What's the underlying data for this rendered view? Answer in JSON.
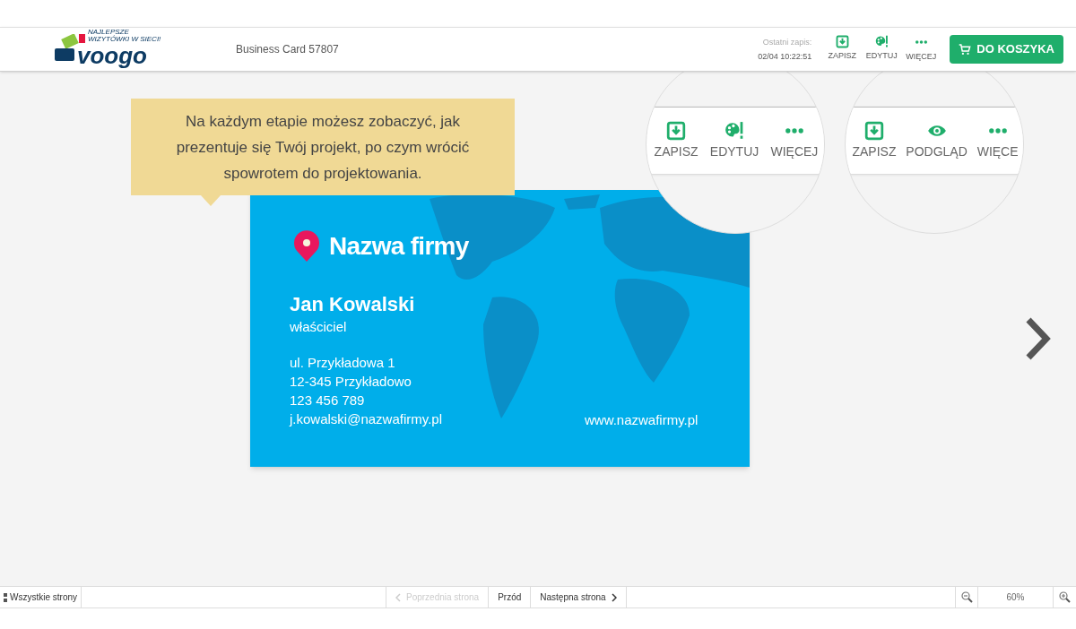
{
  "header": {
    "logo": {
      "tagline": "NAJLEPSZE WIZYTÓWKI W SIECI!",
      "wordmark": "voogo"
    },
    "project_title": "Business Card 57807",
    "last_save_label": "Ostatni zapis:",
    "last_save_time": "02/04 10:22:51",
    "actions": [
      {
        "kind": "save",
        "label": "ZAPISZ"
      },
      {
        "kind": "edit",
        "label": "EDYTUJ"
      },
      {
        "kind": "more",
        "label": "WIĘCEJ"
      }
    ],
    "cart_button": "DO KOSZYKA"
  },
  "tooltip": "Na każdym etapie możesz zobaczyć, jak prezentuje się Twój projekt, po czym wrócić spowrotem do projektowania.",
  "magnifiers": [
    {
      "actions": [
        {
          "kind": "save",
          "label": "ZAPISZ"
        },
        {
          "kind": "edit",
          "label": "EDYTUJ"
        },
        {
          "kind": "more",
          "label": "WIĘCEJ"
        }
      ]
    },
    {
      "actions": [
        {
          "kind": "save",
          "label": "ZAPISZ"
        },
        {
          "kind": "preview",
          "label": "PODGLĄD"
        },
        {
          "kind": "more",
          "label": "WIĘCE"
        }
      ]
    }
  ],
  "card": {
    "company": "Nazwa firmy",
    "name": "Jan Kowalski",
    "role": "właściciel",
    "lines": [
      "ul. Przykładowa 1",
      "12-345 Przykładowo",
      "123 456 789",
      "j.kowalski@nazwafirmy.pl"
    ],
    "website": "www.nazwafirmy.pl"
  },
  "bottom_bar": {
    "all_pages": "Wszystkie strony",
    "prev_page": {
      "label": "Poprzednia strona",
      "disabled": true
    },
    "front": "Przód",
    "next_page": {
      "label": "Następna strona",
      "disabled": false
    },
    "zoom": "60%"
  }
}
